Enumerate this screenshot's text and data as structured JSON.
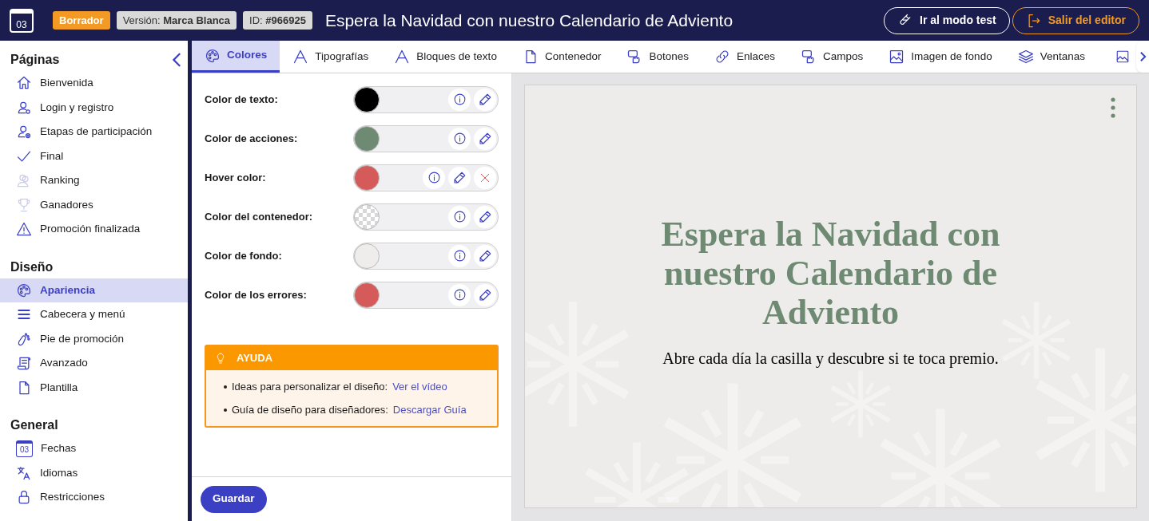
{
  "header": {
    "logo_day": "03",
    "status_badge": "Borrador",
    "version_badge": "Versión: **Marca Blanca**",
    "id_badge": "ID: **#966925**",
    "title": "Espera la Navidad con nuestro Calendario de Adviento",
    "buttons": [
      {
        "kind": "test",
        "label": "Ir al modo test"
      },
      {
        "kind": "exit",
        "label": "Salir del editor"
      }
    ]
  },
  "sidebar": {
    "sections": [
      {
        "title": "Páginas",
        "items": [
          {
            "label": "Bienvenida",
            "disabled": false,
            "selected": false
          },
          {
            "label": "Login y registro",
            "disabled": false,
            "selected": false
          },
          {
            "label": "Etapas de participación",
            "disabled": false,
            "selected": false
          },
          {
            "label": "Final",
            "disabled": false,
            "selected": false
          },
          {
            "label": "Ranking",
            "disabled": true,
            "selected": false
          },
          {
            "label": "Ganadores",
            "disabled": true,
            "selected": false
          },
          {
            "label": "Promoción finalizada",
            "disabled": false,
            "selected": false
          }
        ]
      },
      {
        "title": "Diseño",
        "items": [
          {
            "label": "Apariencia",
            "disabled": false,
            "selected": true
          },
          {
            "label": "Cabecera y menú",
            "disabled": false,
            "selected": false
          },
          {
            "label": "Pie de promoción",
            "disabled": false,
            "selected": false
          },
          {
            "label": "Avanzado",
            "disabled": false,
            "selected": false
          },
          {
            "label": "Plantilla",
            "disabled": false,
            "selected": false
          }
        ]
      },
      {
        "title": "General",
        "items": [
          {
            "label": "Fechas",
            "icon_text": "03",
            "disabled": false,
            "selected": false
          },
          {
            "label": "Idiomas",
            "disabled": false,
            "selected": false
          },
          {
            "label": "Restricciones",
            "disabled": false,
            "selected": false
          }
        ]
      }
    ]
  },
  "tabs": [
    {
      "label": "Colores",
      "selected": true
    },
    {
      "label": "Tipografías",
      "selected": false
    },
    {
      "label": "Bloques de texto",
      "selected": false
    },
    {
      "label": "Contenedor",
      "selected": false
    },
    {
      "label": "Botones",
      "selected": false
    },
    {
      "label": "Enlaces",
      "selected": false
    },
    {
      "label": "Campos",
      "selected": false
    },
    {
      "label": "Imagen de fondo",
      "selected": false
    },
    {
      "label": "Ventanas",
      "selected": false
    }
  ],
  "colors": [
    {
      "label": "Color de texto:",
      "kind": "solid",
      "color": "#000000",
      "clearable": false
    },
    {
      "label": "Color de acciones:",
      "kind": "solid",
      "color": "#6e8a72",
      "clearable": false
    },
    {
      "label": "Hover color:",
      "kind": "solid",
      "color": "#d55a5a",
      "clearable": true
    },
    {
      "label": "Color del contenedor:",
      "kind": "transparent",
      "clearable": false
    },
    {
      "label": "Color de fondo:",
      "kind": "solid",
      "color": "#eeedeb",
      "clearable": false
    },
    {
      "label": "Color de los errores:",
      "kind": "solid",
      "color": "#d55a5a",
      "clearable": false
    }
  ],
  "help": {
    "title": "AYUDA",
    "items": [
      {
        "text": "Ideas para personalizar el diseño:",
        "link": "Ver el vídeo"
      },
      {
        "text": "Guía de diseño para diseñadores:",
        "link": "Descargar Guía"
      }
    ]
  },
  "save_button": "Guardar",
  "preview": {
    "title": "Espera la Navidad con nuestro Calendario de Adviento",
    "subtitle": "Abre cada día la casilla y descubre si te toca premio."
  }
}
